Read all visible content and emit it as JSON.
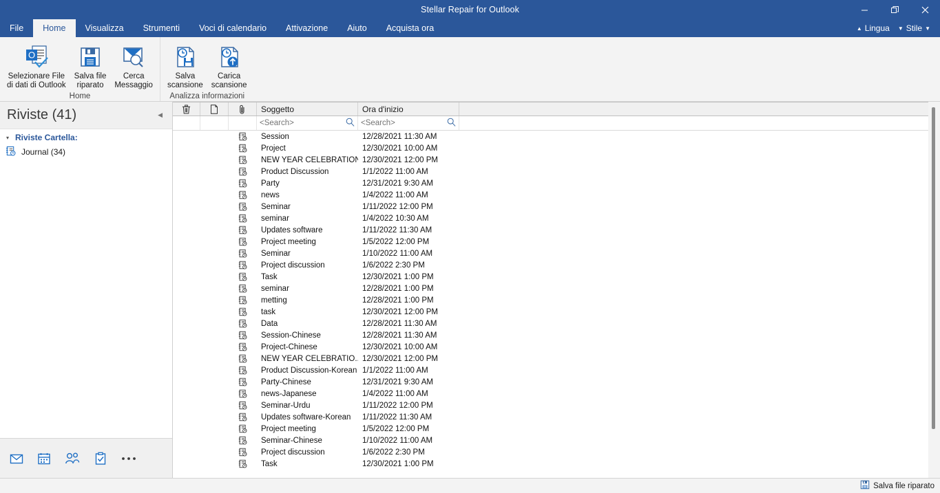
{
  "window": {
    "title": "Stellar Repair for Outlook",
    "controls": [
      {
        "name": "minimize",
        "glyph": "–"
      },
      {
        "name": "restore",
        "glyph": "❐"
      },
      {
        "name": "close",
        "glyph": "✕"
      }
    ]
  },
  "menubar": {
    "items": [
      {
        "label": "File",
        "active": false
      },
      {
        "label": "Home",
        "active": true
      },
      {
        "label": "Visualizza",
        "active": false
      },
      {
        "label": "Strumenti",
        "active": false
      },
      {
        "label": "Voci di calendario",
        "active": false
      },
      {
        "label": "Attivazione",
        "active": false
      },
      {
        "label": "Aiuto",
        "active": false
      },
      {
        "label": "Acquista ora",
        "active": false
      }
    ],
    "right": [
      {
        "label": "Lingua",
        "icon": "caret-up-icon"
      },
      {
        "label": "Stile",
        "icon": "caret-down-icon"
      }
    ]
  },
  "ribbon": {
    "groups": [
      {
        "label": "Home",
        "buttons": [
          {
            "label": "Selezionare File\ndi dati di Outlook",
            "icon": "outlook-data-file-icon"
          },
          {
            "label": "Salva file\nriparato",
            "icon": "save-icon"
          },
          {
            "label": "Cerca\nMessaggio",
            "icon": "find-message-icon"
          }
        ]
      },
      {
        "label": "Analizza informazioni",
        "buttons": [
          {
            "label": "Salva\nscansione",
            "icon": "save-scan-icon"
          },
          {
            "label": "Carica\nscansione",
            "icon": "load-scan-icon"
          }
        ]
      }
    ]
  },
  "sidebar": {
    "title": "Riviste (41)",
    "collapse_icon": "collapse-panel-icon",
    "root": {
      "label": "Riviste Cartella:",
      "arrow": "◢"
    },
    "nodes": [
      {
        "label": "Journal (34)",
        "icon": "journal-icon"
      }
    ],
    "nav": [
      {
        "name": "mail-icon"
      },
      {
        "name": "calendar-icon"
      },
      {
        "name": "people-icon"
      },
      {
        "name": "tasks-icon"
      },
      {
        "name": "more-icon"
      }
    ]
  },
  "grid": {
    "columns": [
      {
        "key": "delete",
        "label": "",
        "icon": "trash-icon"
      },
      {
        "key": "doc",
        "label": "",
        "icon": "document-icon"
      },
      {
        "key": "attachment",
        "label": "",
        "icon": "paperclip-icon"
      },
      {
        "key": "subject",
        "label": "Soggetto"
      },
      {
        "key": "start",
        "label": "Ora d'inizio"
      },
      {
        "key": "rest",
        "label": ""
      }
    ],
    "search": {
      "placeholder": "<Search>",
      "subject_value": "",
      "start_value": "",
      "icon": "search-icon"
    },
    "rows": [
      {
        "icon": "journal-entry-icon",
        "subject": "Session",
        "start": "12/28/2021 11:30 AM"
      },
      {
        "icon": "journal-entry-icon",
        "subject": "Project",
        "start": "12/30/2021 10:00 AM"
      },
      {
        "icon": "journal-entry-icon",
        "subject": "NEW YEAR CELEBRATION",
        "start": "12/30/2021 12:00 PM"
      },
      {
        "icon": "journal-entry-icon",
        "subject": "Product Discussion",
        "start": "1/1/2022 11:00 AM"
      },
      {
        "icon": "journal-entry-icon",
        "subject": "Party",
        "start": "12/31/2021 9:30 AM"
      },
      {
        "icon": "journal-entry-icon",
        "subject": "news",
        "start": "1/4/2022 11:00 AM"
      },
      {
        "icon": "journal-entry-icon",
        "subject": "Seminar",
        "start": "1/11/2022 12:00 PM"
      },
      {
        "icon": "journal-entry-icon",
        "subject": "seminar",
        "start": "1/4/2022 10:30 AM"
      },
      {
        "icon": "journal-entry-icon",
        "subject": "Updates software",
        "start": "1/11/2022 11:30 AM"
      },
      {
        "icon": "journal-entry-icon",
        "subject": "Project meeting",
        "start": "1/5/2022 12:00 PM"
      },
      {
        "icon": "journal-entry-icon",
        "subject": "Seminar",
        "start": "1/10/2022 11:00 AM"
      },
      {
        "icon": "journal-entry-icon",
        "subject": "Project discussion",
        "start": "1/6/2022 2:30 PM"
      },
      {
        "icon": "journal-entry-icon",
        "subject": "Task",
        "start": "12/30/2021 1:00 PM"
      },
      {
        "icon": "journal-entry-icon",
        "subject": "seminar",
        "start": "12/28/2021 1:00 PM"
      },
      {
        "icon": "journal-entry-icon",
        "subject": "metting",
        "start": "12/28/2021 1:00 PM"
      },
      {
        "icon": "journal-entry-icon",
        "subject": "task",
        "start": "12/30/2021 12:00 PM"
      },
      {
        "icon": "journal-entry-icon",
        "subject": "Data",
        "start": "12/28/2021 11:30 AM"
      },
      {
        "icon": "journal-entry-icon",
        "subject": "Session-Chinese",
        "start": "12/28/2021 11:30 AM"
      },
      {
        "icon": "journal-entry-icon",
        "subject": "Project-Chinese",
        "start": "12/30/2021 10:00 AM"
      },
      {
        "icon": "journal-entry-icon",
        "subject": "NEW YEAR CELEBRATIO...",
        "start": "12/30/2021 12:00 PM"
      },
      {
        "icon": "journal-entry-icon",
        "subject": "Product Discussion-Korean",
        "start": "1/1/2022 11:00 AM"
      },
      {
        "icon": "journal-entry-icon",
        "subject": "Party-Chinese",
        "start": "12/31/2021 9:30 AM"
      },
      {
        "icon": "journal-entry-icon",
        "subject": "news-Japanese",
        "start": "1/4/2022 11:00 AM"
      },
      {
        "icon": "journal-entry-icon",
        "subject": "Seminar-Urdu",
        "start": "1/11/2022 12:00 PM"
      },
      {
        "icon": "journal-entry-icon",
        "subject": "Updates software-Korean",
        "start": "1/11/2022 11:30 AM"
      },
      {
        "icon": "journal-entry-icon",
        "subject": "Project meeting",
        "start": "1/5/2022 12:00 PM"
      },
      {
        "icon": "journal-entry-icon",
        "subject": "Seminar-Chinese",
        "start": "1/10/2022 11:00 AM"
      },
      {
        "icon": "journal-entry-icon",
        "subject": "Project discussion",
        "start": "1/6/2022 2:30 PM"
      },
      {
        "icon": "journal-entry-icon",
        "subject": "Task",
        "start": "12/30/2021 1:00 PM"
      }
    ]
  },
  "statusbar": {
    "action": {
      "label": "Salva file riparato",
      "icon": "save-icon"
    }
  },
  "colors": {
    "brand_blue": "#2b579a",
    "icon_blue": "#1f6fc4",
    "ribbon_bg": "#f3f3f3",
    "sidebar_bg": "#f0f0f0",
    "link_blue": "#2b579a"
  }
}
